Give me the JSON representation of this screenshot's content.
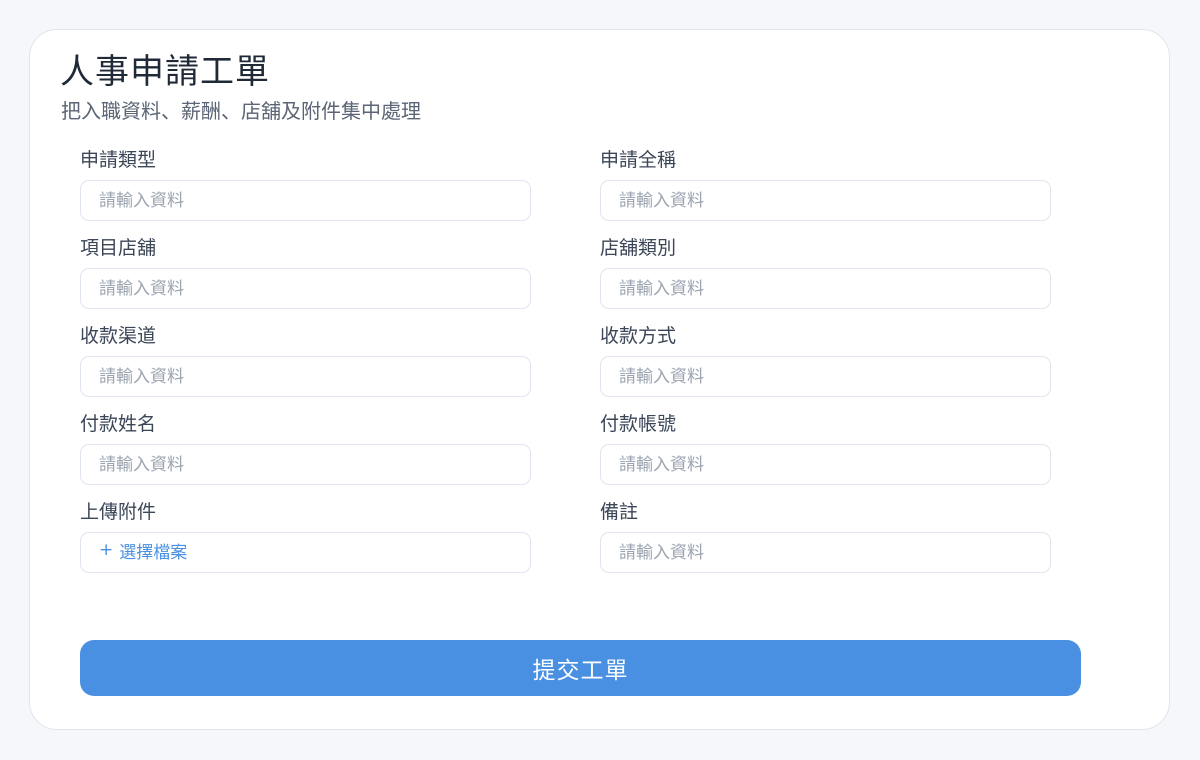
{
  "header": {
    "title": "人事申請工單",
    "subtitle": "把入職資料、薪酬、店舖及附件集中處理"
  },
  "fields": {
    "application_type": {
      "label": "申請類型",
      "placeholder": "請輸入資料"
    },
    "application_name": {
      "label": "申請全稱",
      "placeholder": "請輸入資料"
    },
    "project_store": {
      "label": "項目店舖",
      "placeholder": "請輸入資料"
    },
    "store_category": {
      "label": "店舖類別",
      "placeholder": "請輸入資料"
    },
    "receipt_channel": {
      "label": "收款渠道",
      "placeholder": "請輸入資料"
    },
    "receipt_method": {
      "label": "收款方式",
      "placeholder": "請輸入資料"
    },
    "payer_name": {
      "label": "付款姓名",
      "placeholder": "請輸入資料"
    },
    "payer_account": {
      "label": "付款帳號",
      "placeholder": "請輸入資料"
    },
    "attachment": {
      "label": "上傳附件",
      "button_icon": "+",
      "button_text": "選擇檔案"
    },
    "remarks": {
      "label": "備註",
      "placeholder": "請輸入資料"
    }
  },
  "submit": {
    "label": "提交工單"
  },
  "colors": {
    "accent": "#4a90e2",
    "page_background": "#f5f7fb",
    "card_background": "#ffffff",
    "border": "#dfe5ee",
    "title_text": "#1f2937",
    "label_text": "#3b4657",
    "placeholder_text": "#9aa3af"
  },
  "icons": {
    "attachment": "plus-icon"
  }
}
